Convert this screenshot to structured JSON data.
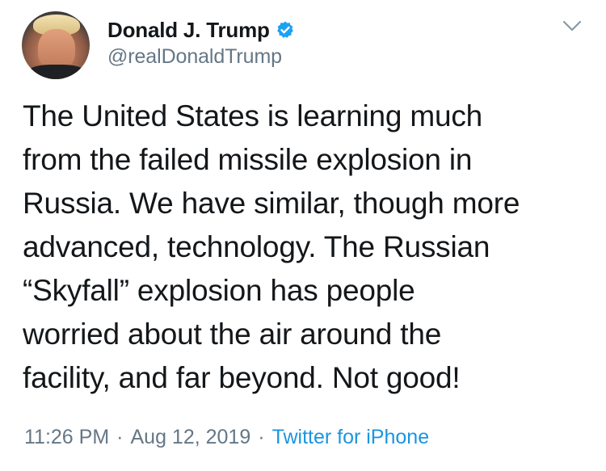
{
  "author": {
    "display_name": "Donald J. Trump",
    "handle": "@realDonaldTrump",
    "verified": true
  },
  "tweet": {
    "text": "The United States is learning much\nfrom the failed missile explosion in\nRussia. We have similar, though more\nadvanced, technology. The Russian\n“Skyfall” explosion has people\nworried about the air around the\nfacility, and far beyond. Not good!",
    "time": "11:26 PM",
    "separator": "·",
    "date": "Aug 12, 2019",
    "source": "Twitter for iPhone"
  },
  "icons": {
    "verified": "verified-badge-icon",
    "menu": "chevron-down-icon"
  },
  "colors": {
    "text": "#14171a",
    "secondary": "#657786",
    "link": "#1b95e0",
    "verified": "#1da1f2"
  }
}
